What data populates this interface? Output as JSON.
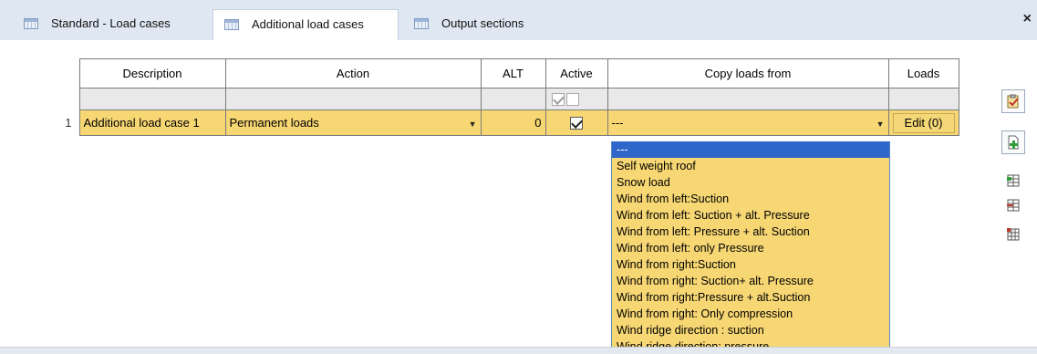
{
  "tabs": [
    {
      "label": "Standard - Load cases"
    },
    {
      "label": "Additional load cases",
      "active": true
    },
    {
      "label": "Output sections"
    }
  ],
  "close_label": "×",
  "grid": {
    "columns": [
      "Description",
      "Action",
      "ALT",
      "Active",
      "Copy loads from",
      "Loads"
    ],
    "rows": [
      {
        "index": "1",
        "description": "Additional load case 1",
        "action": "Permanent loads",
        "alt": "0",
        "active": true,
        "copy_from": "---",
        "loads_button": "Edit (0)"
      }
    ]
  },
  "copy_from_options": [
    "---",
    "Self weight roof",
    "Snow load",
    "Wind from left:Suction",
    "Wind from left: Suction + alt. Pressure",
    "Wind from left: Pressure + alt. Suction",
    "Wind from left: only Pressure",
    "Wind from right:Suction",
    "Wind from right: Suction+ alt. Pressure",
    "Wind from right:Pressure + alt.Suction",
    "Wind from right: Only compression",
    "Wind ridge direction : suction",
    "Wind ridge direction: pressure"
  ],
  "selected_option_index": 0,
  "toolbar": {
    "icons": [
      "clipboard-check-icon",
      "add-document-icon",
      "insert-row-icon",
      "delete-row-icon",
      "table-columns-icon"
    ]
  },
  "colors": {
    "accent": "#f7d774",
    "selection": "#2f66c9",
    "tabbar": "#dfe7f3"
  }
}
